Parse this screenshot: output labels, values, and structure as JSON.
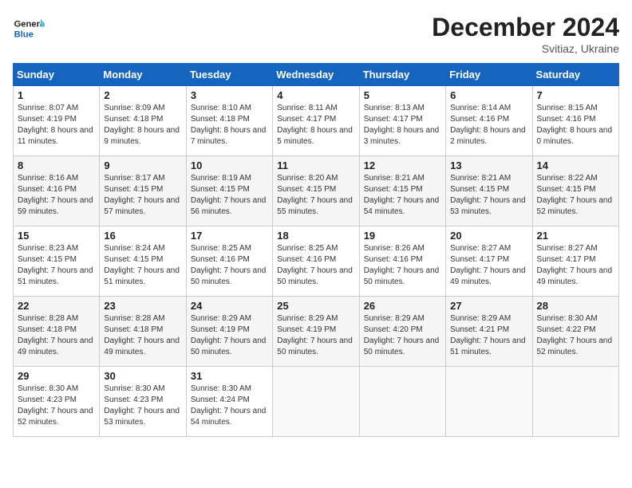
{
  "header": {
    "month": "December 2024",
    "location": "Svitiaz, Ukraine",
    "logo_general": "General",
    "logo_blue": "Blue"
  },
  "weekdays": [
    "Sunday",
    "Monday",
    "Tuesday",
    "Wednesday",
    "Thursday",
    "Friday",
    "Saturday"
  ],
  "weeks": [
    [
      {
        "day": "1",
        "sunrise": "8:07 AM",
        "sunset": "4:19 PM",
        "daylight": "8 hours and 11 minutes."
      },
      {
        "day": "2",
        "sunrise": "8:09 AM",
        "sunset": "4:18 PM",
        "daylight": "8 hours and 9 minutes."
      },
      {
        "day": "3",
        "sunrise": "8:10 AM",
        "sunset": "4:18 PM",
        "daylight": "8 hours and 7 minutes."
      },
      {
        "day": "4",
        "sunrise": "8:11 AM",
        "sunset": "4:17 PM",
        "daylight": "8 hours and 5 minutes."
      },
      {
        "day": "5",
        "sunrise": "8:13 AM",
        "sunset": "4:17 PM",
        "daylight": "8 hours and 3 minutes."
      },
      {
        "day": "6",
        "sunrise": "8:14 AM",
        "sunset": "4:16 PM",
        "daylight": "8 hours and 2 minutes."
      },
      {
        "day": "7",
        "sunrise": "8:15 AM",
        "sunset": "4:16 PM",
        "daylight": "8 hours and 0 minutes."
      }
    ],
    [
      {
        "day": "8",
        "sunrise": "8:16 AM",
        "sunset": "4:16 PM",
        "daylight": "7 hours and 59 minutes."
      },
      {
        "day": "9",
        "sunrise": "8:17 AM",
        "sunset": "4:15 PM",
        "daylight": "7 hours and 57 minutes."
      },
      {
        "day": "10",
        "sunrise": "8:19 AM",
        "sunset": "4:15 PM",
        "daylight": "7 hours and 56 minutes."
      },
      {
        "day": "11",
        "sunrise": "8:20 AM",
        "sunset": "4:15 PM",
        "daylight": "7 hours and 55 minutes."
      },
      {
        "day": "12",
        "sunrise": "8:21 AM",
        "sunset": "4:15 PM",
        "daylight": "7 hours and 54 minutes."
      },
      {
        "day": "13",
        "sunrise": "8:21 AM",
        "sunset": "4:15 PM",
        "daylight": "7 hours and 53 minutes."
      },
      {
        "day": "14",
        "sunrise": "8:22 AM",
        "sunset": "4:15 PM",
        "daylight": "7 hours and 52 minutes."
      }
    ],
    [
      {
        "day": "15",
        "sunrise": "8:23 AM",
        "sunset": "4:15 PM",
        "daylight": "7 hours and 51 minutes."
      },
      {
        "day": "16",
        "sunrise": "8:24 AM",
        "sunset": "4:15 PM",
        "daylight": "7 hours and 51 minutes."
      },
      {
        "day": "17",
        "sunrise": "8:25 AM",
        "sunset": "4:16 PM",
        "daylight": "7 hours and 50 minutes."
      },
      {
        "day": "18",
        "sunrise": "8:25 AM",
        "sunset": "4:16 PM",
        "daylight": "7 hours and 50 minutes."
      },
      {
        "day": "19",
        "sunrise": "8:26 AM",
        "sunset": "4:16 PM",
        "daylight": "7 hours and 50 minutes."
      },
      {
        "day": "20",
        "sunrise": "8:27 AM",
        "sunset": "4:17 PM",
        "daylight": "7 hours and 49 minutes."
      },
      {
        "day": "21",
        "sunrise": "8:27 AM",
        "sunset": "4:17 PM",
        "daylight": "7 hours and 49 minutes."
      }
    ],
    [
      {
        "day": "22",
        "sunrise": "8:28 AM",
        "sunset": "4:18 PM",
        "daylight": "7 hours and 49 minutes."
      },
      {
        "day": "23",
        "sunrise": "8:28 AM",
        "sunset": "4:18 PM",
        "daylight": "7 hours and 49 minutes."
      },
      {
        "day": "24",
        "sunrise": "8:29 AM",
        "sunset": "4:19 PM",
        "daylight": "7 hours and 50 minutes."
      },
      {
        "day": "25",
        "sunrise": "8:29 AM",
        "sunset": "4:19 PM",
        "daylight": "7 hours and 50 minutes."
      },
      {
        "day": "26",
        "sunrise": "8:29 AM",
        "sunset": "4:20 PM",
        "daylight": "7 hours and 50 minutes."
      },
      {
        "day": "27",
        "sunrise": "8:29 AM",
        "sunset": "4:21 PM",
        "daylight": "7 hours and 51 minutes."
      },
      {
        "day": "28",
        "sunrise": "8:30 AM",
        "sunset": "4:22 PM",
        "daylight": "7 hours and 52 minutes."
      }
    ],
    [
      {
        "day": "29",
        "sunrise": "8:30 AM",
        "sunset": "4:23 PM",
        "daylight": "7 hours and 52 minutes."
      },
      {
        "day": "30",
        "sunrise": "8:30 AM",
        "sunset": "4:23 PM",
        "daylight": "7 hours and 53 minutes."
      },
      {
        "day": "31",
        "sunrise": "8:30 AM",
        "sunset": "4:24 PM",
        "daylight": "7 hours and 54 minutes."
      },
      null,
      null,
      null,
      null
    ]
  ],
  "labels": {
    "sunrise": "Sunrise: ",
    "sunset": "Sunset: ",
    "daylight": "Daylight: "
  }
}
